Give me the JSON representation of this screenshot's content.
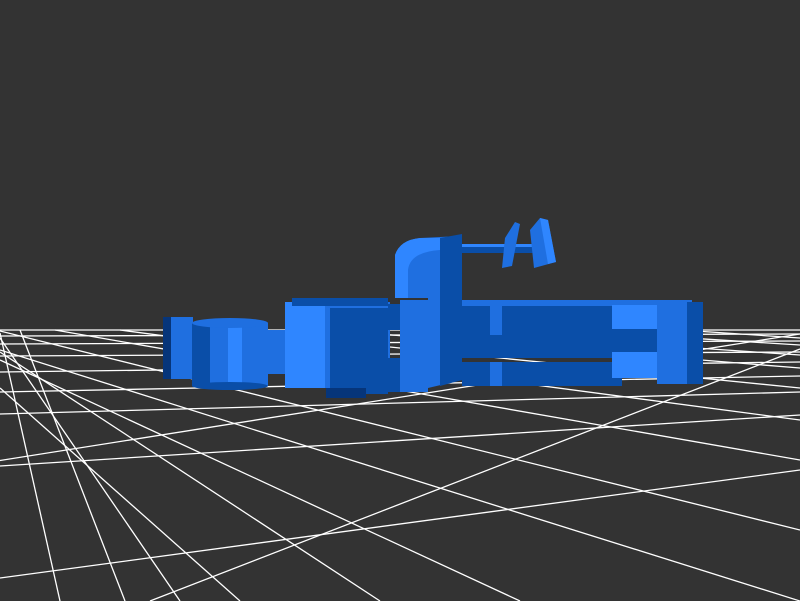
{
  "scene": {
    "background_color": "#333333",
    "grid_color": "#ffffff",
    "model_color": "#1f6fe0",
    "model_shade_color": "#0a4ea8",
    "model_highlight_color": "#2f86ff",
    "model_dark_color": "#06357a",
    "description_visible_text": ""
  }
}
